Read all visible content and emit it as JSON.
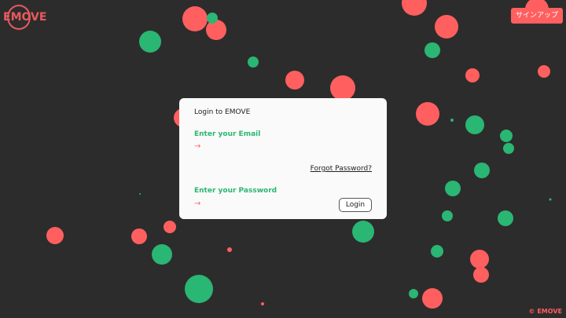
{
  "brand": {
    "logo_text": "EMOVE",
    "accent_color": "#ff5f5f",
    "green_color": "#2ab673",
    "background_color": "#2d2c2c"
  },
  "header": {
    "signup_label": "サインアップ"
  },
  "login": {
    "title": "Login to EMOVE",
    "email_label": "Enter your Email",
    "email_arrow": "→",
    "email_value": "",
    "forgot_password": "Forgot Password?",
    "password_label": "Enter your Password",
    "password_arrow": "→",
    "password_value": "",
    "submit_label": "Login"
  },
  "footer": {
    "copyright": "© EMOVE"
  }
}
